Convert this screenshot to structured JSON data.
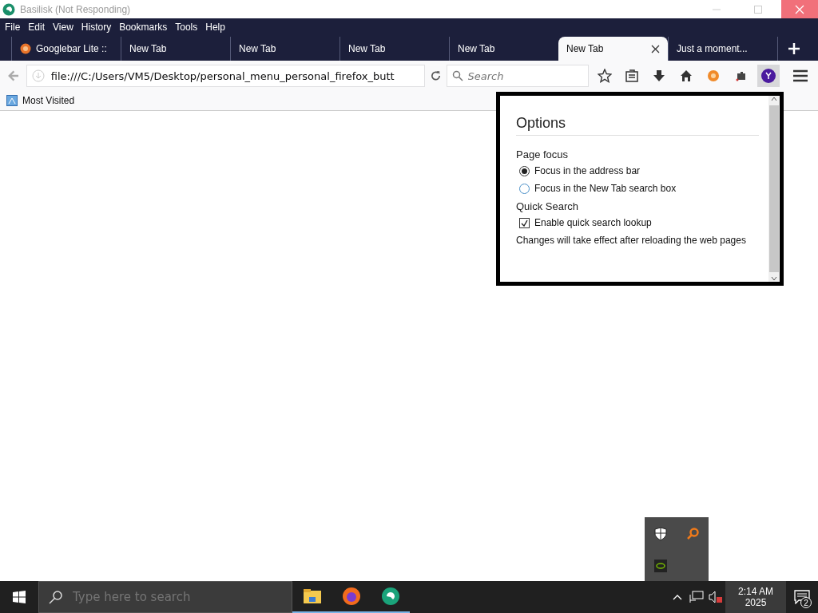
{
  "window": {
    "title": "Basilisk (Not Responding)"
  },
  "menu": [
    "File",
    "Edit",
    "View",
    "History",
    "Bookmarks",
    "Tools",
    "Help"
  ],
  "tabs": [
    {
      "label": "Googlebar Lite ::",
      "selected": false,
      "icon": true
    },
    {
      "label": "New Tab",
      "selected": false
    },
    {
      "label": "New Tab",
      "selected": false
    },
    {
      "label": "New Tab",
      "selected": false
    },
    {
      "label": "New Tab",
      "selected": false
    },
    {
      "label": "New Tab",
      "selected": true
    },
    {
      "label": "Just a moment...",
      "selected": false
    }
  ],
  "address": {
    "value": "file:///C:/Users/VM5/Desktop/personal_menu_personal_firefox_butt"
  },
  "search": {
    "placeholder": "Search"
  },
  "bookmarks": [
    {
      "label": "Most Visited"
    }
  ],
  "popup": {
    "title": "Options",
    "sections": [
      {
        "heading": "Page focus",
        "items": [
          {
            "kind": "radio",
            "label": "Focus in the address bar",
            "selected": true
          },
          {
            "kind": "radio",
            "label": "Focus in the New Tab search box",
            "selected": false
          }
        ]
      },
      {
        "heading": "Quick Search",
        "items": [
          {
            "kind": "checkbox",
            "label": "Enable quick search lookup",
            "checked": true
          }
        ]
      }
    ],
    "note": "Changes will take effect after reloading the web pages"
  },
  "taskbar": {
    "search_placeholder": "Type here to search",
    "time": "2:14 AM",
    "date": "2025",
    "notifications": "2"
  }
}
